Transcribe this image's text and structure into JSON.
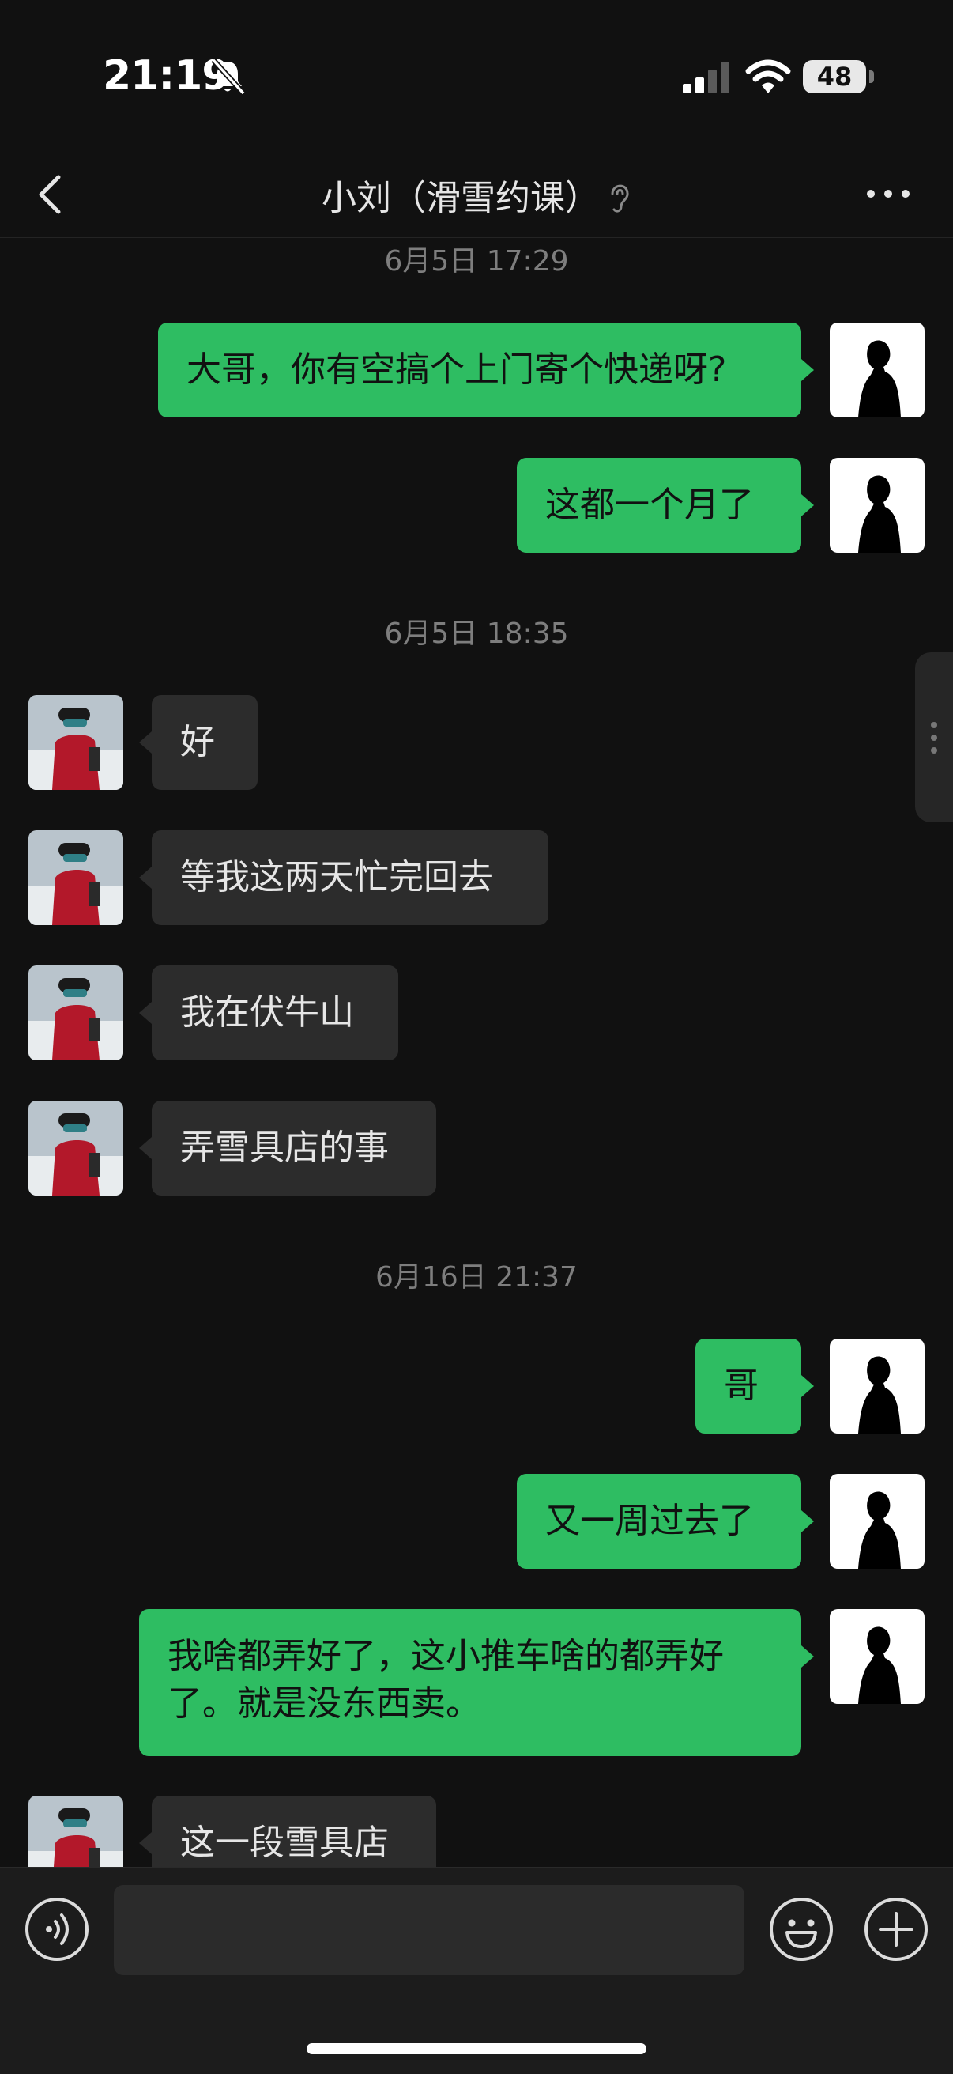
{
  "status_bar": {
    "time": "21:19",
    "battery": "48",
    "icons": [
      "bell-off-icon",
      "cellular-signal-icon",
      "wifi-icon",
      "battery-icon"
    ]
  },
  "header": {
    "title": "小刘（滑雪约课）",
    "icons": [
      "back-chevron-icon",
      "ear-icon",
      "more-dots-icon"
    ]
  },
  "chat": {
    "groups": [
      {
        "timestamp": "6月5日 17:29",
        "messages": [
          {
            "from": "me",
            "text": "大哥，你有空搞个上门寄个快递呀?"
          },
          {
            "from": "me",
            "text": "这都一个月了"
          }
        ]
      },
      {
        "timestamp": "6月5日 18:35",
        "messages": [
          {
            "from": "other",
            "text": "好"
          },
          {
            "from": "other",
            "text": "等我这两天忙完回去"
          },
          {
            "from": "other",
            "text": "我在伏牛山"
          },
          {
            "from": "other",
            "text": "弄雪具店的事"
          }
        ]
      },
      {
        "timestamp": "6月16日 21:37",
        "messages": [
          {
            "from": "me",
            "text": "哥"
          },
          {
            "from": "me",
            "text": "又一周过去了"
          },
          {
            "from": "me",
            "text": "我啥都弄好了，这小推车啥的都弄好了。就是没东西卖。"
          },
          {
            "from": "other",
            "text": "这一段雪具店"
          }
        ]
      }
    ]
  },
  "input_bar": {
    "placeholder": "",
    "value": "",
    "icons": [
      "voice-icon",
      "emoji-icon",
      "plus-icon"
    ]
  },
  "colors": {
    "background": "#111111",
    "my_bubble": "#2ebd62",
    "other_bubble": "#2c2c2c",
    "timestamp": "#7e7e7e"
  }
}
